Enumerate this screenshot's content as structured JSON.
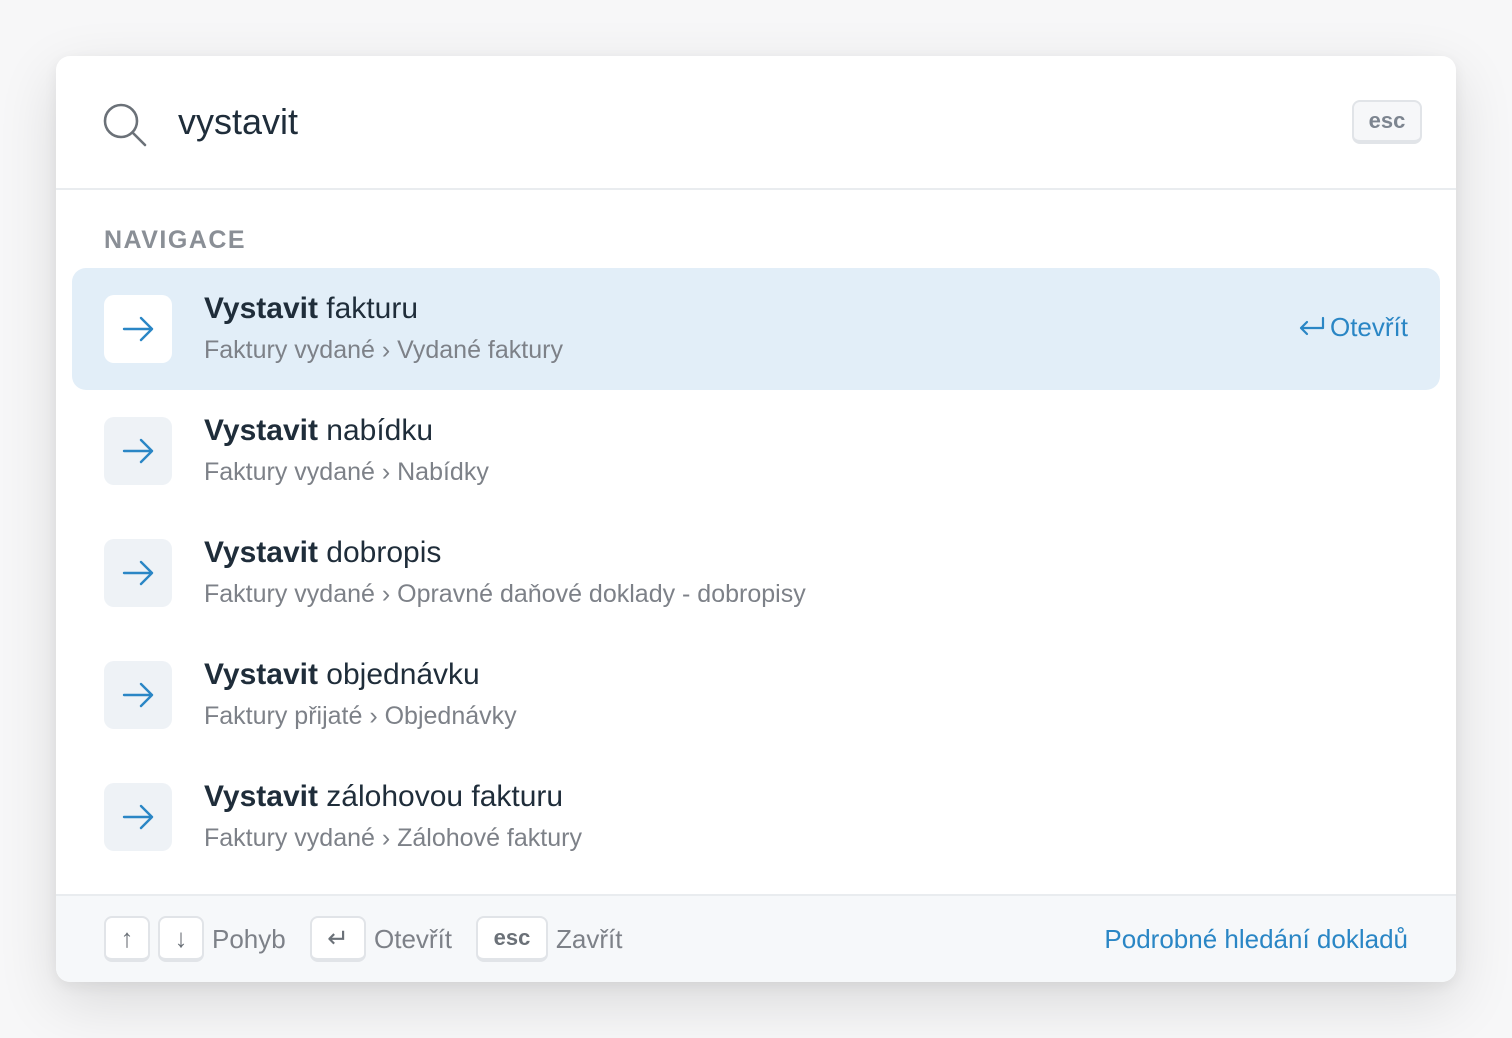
{
  "search": {
    "value": "vystavit",
    "close_key": "esc"
  },
  "section": {
    "title": "NAVIGACE"
  },
  "results": [
    {
      "title_bold": "Vystavit",
      "title_rest": " fakturu",
      "path": "Faktury vydané › Vydané faktury",
      "active": true
    },
    {
      "title_bold": "Vystavit",
      "title_rest": " nabídku",
      "path": "Faktury vydané › Nabídky",
      "active": false
    },
    {
      "title_bold": "Vystavit",
      "title_rest": " dobropis",
      "path": "Faktury vydané › Opravné daňové doklady - dobropisy",
      "active": false
    },
    {
      "title_bold": "Vystavit",
      "title_rest": " objednávku",
      "path": "Faktury přijaté › Objednávky",
      "active": false
    },
    {
      "title_bold": "Vystavit",
      "title_rest": " zálohovou fakturu",
      "path": "Faktury vydané › Zálohové faktury",
      "active": false
    }
  ],
  "active_action": {
    "icon": "enter-icon",
    "label": "Otevřít"
  },
  "footer": {
    "up_key": "↑",
    "down_key": "↓",
    "move_label": "Pohyb",
    "enter_key": "↵",
    "open_label": "Otevřít",
    "esc_key": "esc",
    "close_label": "Zavřít",
    "advanced_link": "Podrobné hledání dokladů"
  },
  "colors": {
    "accent": "#2a86c5",
    "active_row": "#e2eef8",
    "text_primary": "#1f2d3a",
    "text_secondary": "#7d8188"
  }
}
